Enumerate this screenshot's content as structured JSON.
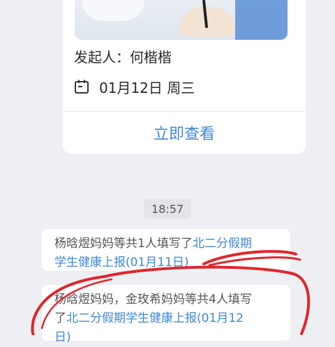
{
  "card": {
    "initiator_label": "发起人：",
    "initiator_name": "何楷楷",
    "date": "01月12日 周三",
    "view_button": "立即查看"
  },
  "timestamp": "18:57",
  "messages": [
    {
      "prefix_line1": "杨晗煜妈妈等共1人填写了",
      "link_line1": "北二分假期",
      "link_line2": "学生健康上报(01月11日)"
    },
    {
      "prefix_line1": "杨晗煜妈妈，金玫希妈妈等共4人填写",
      "prefix_line2": "了",
      "link_line2": "北二分假期学生健康上报(01月12",
      "link_line3": "日)"
    }
  ],
  "icons": {
    "calendar": "calendar-icon"
  },
  "colors": {
    "accent": "#3f89d3",
    "annotation": "#e0262c",
    "background": "#eeeff2"
  }
}
